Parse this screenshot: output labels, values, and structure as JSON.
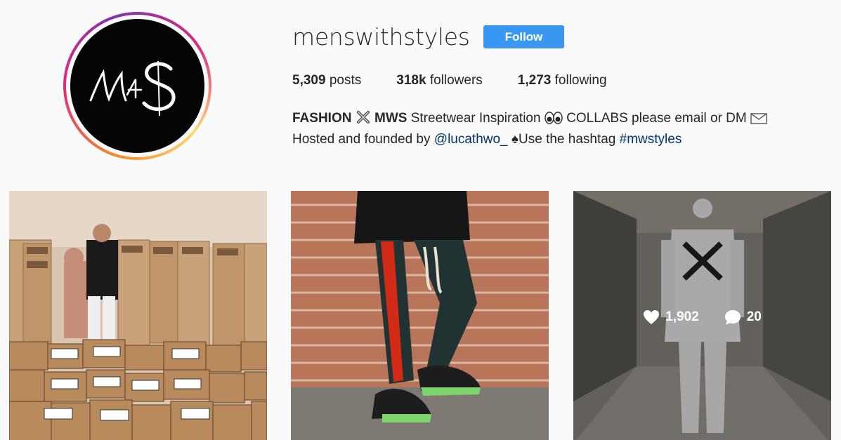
{
  "profile": {
    "username": "menswithstyles",
    "follow_label": "Follow",
    "stats": {
      "posts_count": "5,309",
      "posts_label": "posts",
      "followers_count": "318k",
      "followers_label": "followers",
      "following_count": "1,273",
      "following_label": "following"
    },
    "bio": {
      "line1_bold1": "FASHION",
      "line1_bold2": "MWS",
      "line1_text1": "Streetwear Inspiration",
      "line1_text2": "COLLABS please email or DM",
      "line2_text1": "Hosted and founded by",
      "line2_mention": "@lucathwo_",
      "line2_text2": "Use the hashtag",
      "line2_hashtag": "#mwstyles"
    }
  },
  "posts": [
    {
      "description_icon": "photo"
    },
    {
      "description_icon": "photo"
    },
    {
      "description_icon": "photo",
      "likes": "1,902",
      "comments": "20"
    }
  ],
  "colors": {
    "accent": "#3897f0",
    "link": "#003569",
    "background": "#fafafa"
  }
}
